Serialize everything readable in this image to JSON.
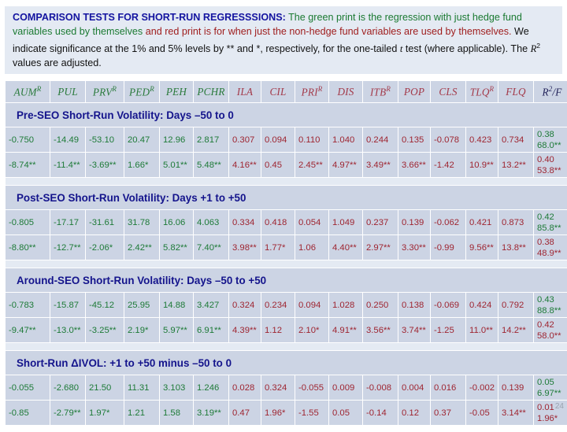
{
  "caption": {
    "lead": "COMPARISON TESTS FOR SHORT-RUN REGRESSSIONS:",
    "green1": " The green print is the regression with just hedge fund variables used by themselves ",
    "red1": "and red print is for when just the non-hedge fund variables are used by themselves.",
    "black1": " We indicate significance at the 1% and 5% levels by ** and *, respectively, for the one-tailed ",
    "t_italic": "t",
    "black2": " test (where applicable). The ",
    "r_italic": "R",
    "r_sup": "2",
    "black3": " values are adjusted."
  },
  "columns": [
    {
      "base": "AUM",
      "sup": "R",
      "color": "g"
    },
    {
      "base": "PUL",
      "sup": "",
      "color": "g"
    },
    {
      "base": "PRV",
      "sup": "R",
      "color": "g"
    },
    {
      "base": "PED",
      "sup": "R",
      "color": "g"
    },
    {
      "base": "PEH",
      "sup": "",
      "color": "g"
    },
    {
      "base": "PCHR",
      "sup": "",
      "color": "g"
    },
    {
      "base": "ILA",
      "sup": "",
      "color": "r"
    },
    {
      "base": "CIL",
      "sup": "",
      "color": "r"
    },
    {
      "base": "PRI",
      "sup": "R",
      "color": "r"
    },
    {
      "base": "DIS",
      "sup": "",
      "color": "r"
    },
    {
      "base": "ITB",
      "sup": "R",
      "color": "r"
    },
    {
      "base": "POP",
      "sup": "",
      "color": "r"
    },
    {
      "base": "CLS",
      "sup": "",
      "color": "r"
    },
    {
      "base": "TLQ",
      "sup": "R",
      "color": "r"
    },
    {
      "base": "FLQ",
      "sup": "",
      "color": "r"
    },
    {
      "base": "R",
      "sup": "2",
      "tail": "/F",
      "color": "k"
    }
  ],
  "sections": [
    {
      "title": "Pre-SEO Short-Run Volatility: Days –50 to 0",
      "rows": [
        {
          "kind": "coef",
          "cells": [
            {
              "v": "-0.750",
              "c": "g"
            },
            {
              "v": "-14.49",
              "c": "g"
            },
            {
              "v": "-53.10",
              "c": "g"
            },
            {
              "v": "20.47",
              "c": "g"
            },
            {
              "v": "12.96",
              "c": "g"
            },
            {
              "v": "2.817",
              "c": "g"
            },
            {
              "v": "0.307",
              "c": "r"
            },
            {
              "v": "0.094",
              "c": "r"
            },
            {
              "v": "0.110",
              "c": "r"
            },
            {
              "v": "1.040",
              "c": "r"
            },
            {
              "v": "0.244",
              "c": "r"
            },
            {
              "v": "0.135",
              "c": "r"
            },
            {
              "v": "-0.078",
              "c": "r"
            },
            {
              "v": "0.423",
              "c": "r"
            },
            {
              "v": "0.734",
              "c": "r"
            }
          ],
          "rsq": {
            "top": "0.38",
            "bottom": "68.0**",
            "c": "g"
          }
        },
        {
          "kind": "tstat",
          "cells": [
            {
              "v": "-8.74**",
              "c": "g"
            },
            {
              "v": "-11.4**",
              "c": "g"
            },
            {
              "v": "-3.69**",
              "c": "g"
            },
            {
              "v": "1.66*",
              "c": "g"
            },
            {
              "v": "5.01**",
              "c": "g"
            },
            {
              "v": "5.48**",
              "c": "g"
            },
            {
              "v": "4.16**",
              "c": "r"
            },
            {
              "v": "0.45",
              "c": "r"
            },
            {
              "v": "2.45**",
              "c": "r"
            },
            {
              "v": "4.97**",
              "c": "r"
            },
            {
              "v": "3.49**",
              "c": "r"
            },
            {
              "v": "3.66**",
              "c": "r"
            },
            {
              "v": "-1.42",
              "c": "r"
            },
            {
              "v": "10.9**",
              "c": "r"
            },
            {
              "v": "13.2**",
              "c": "r"
            }
          ],
          "rsq": {
            "top": "0.40",
            "bottom": "53.8**",
            "c": "r"
          }
        }
      ]
    },
    {
      "title": "Post-SEO Short-Run Volatility: Days +1 to +50",
      "rows": [
        {
          "kind": "coef",
          "cells": [
            {
              "v": "-0.805",
              "c": "g"
            },
            {
              "v": "-17.17",
              "c": "g"
            },
            {
              "v": "-31.61",
              "c": "g"
            },
            {
              "v": "31.78",
              "c": "g"
            },
            {
              "v": "16.06",
              "c": "g"
            },
            {
              "v": "4.063",
              "c": "g"
            },
            {
              "v": "0.334",
              "c": "r"
            },
            {
              "v": "0.418",
              "c": "r"
            },
            {
              "v": "0.054",
              "c": "r"
            },
            {
              "v": "1.049",
              "c": "r"
            },
            {
              "v": "0.237",
              "c": "r"
            },
            {
              "v": "0.139",
              "c": "r"
            },
            {
              "v": "-0.062",
              "c": "r"
            },
            {
              "v": "0.421",
              "c": "r"
            },
            {
              "v": "0.873",
              "c": "r"
            }
          ],
          "rsq": {
            "top": "0.42",
            "bottom": "85.8**",
            "c": "g"
          }
        },
        {
          "kind": "tstat",
          "cells": [
            {
              "v": "-8.80**",
              "c": "g"
            },
            {
              "v": "-12.7**",
              "c": "g"
            },
            {
              "v": "-2.06*",
              "c": "g"
            },
            {
              "v": "2.42**",
              "c": "g"
            },
            {
              "v": "5.82**",
              "c": "g"
            },
            {
              "v": "7.40**",
              "c": "g"
            },
            {
              "v": "3.98**",
              "c": "r"
            },
            {
              "v": "1.77*",
              "c": "r"
            },
            {
              "v": "1.06",
              "c": "r"
            },
            {
              "v": "4.40**",
              "c": "r"
            },
            {
              "v": "2.97**",
              "c": "r"
            },
            {
              "v": "3.30**",
              "c": "r"
            },
            {
              "v": "-0.99",
              "c": "r"
            },
            {
              "v": "9.56**",
              "c": "r"
            },
            {
              "v": "13.8**",
              "c": "r"
            }
          ],
          "rsq": {
            "top": "0.38",
            "bottom": "48.9**",
            "c": "r"
          }
        }
      ]
    },
    {
      "title": "Around-SEO Short-Run Volatility: Days –50 to +50",
      "rows": [
        {
          "kind": "coef",
          "cells": [
            {
              "v": "-0.783",
              "c": "g"
            },
            {
              "v": "-15.87",
              "c": "g"
            },
            {
              "v": "-45.12",
              "c": "g"
            },
            {
              "v": "25.95",
              "c": "g"
            },
            {
              "v": "14.88",
              "c": "g"
            },
            {
              "v": "3.427",
              "c": "g"
            },
            {
              "v": "0.324",
              "c": "r"
            },
            {
              "v": "0.234",
              "c": "r"
            },
            {
              "v": "0.094",
              "c": "r"
            },
            {
              "v": "1.028",
              "c": "r"
            },
            {
              "v": "0.250",
              "c": "r"
            },
            {
              "v": "0.138",
              "c": "r"
            },
            {
              "v": "-0.069",
              "c": "r"
            },
            {
              "v": "0.424",
              "c": "r"
            },
            {
              "v": "0.792",
              "c": "r"
            }
          ],
          "rsq": {
            "top": "0.43",
            "bottom": "88.8**",
            "c": "g"
          }
        },
        {
          "kind": "tstat",
          "cells": [
            {
              "v": "-9.47**",
              "c": "g"
            },
            {
              "v": "-13.0**",
              "c": "g"
            },
            {
              "v": "-3.25**",
              "c": "g"
            },
            {
              "v": "2.19*",
              "c": "g"
            },
            {
              "v": "5.97**",
              "c": "g"
            },
            {
              "v": "6.91**",
              "c": "g"
            },
            {
              "v": "4.39**",
              "c": "r"
            },
            {
              "v": "1.12",
              "c": "r"
            },
            {
              "v": "2.10*",
              "c": "r"
            },
            {
              "v": "4.91**",
              "c": "r"
            },
            {
              "v": "3.56**",
              "c": "r"
            },
            {
              "v": "3.74**",
              "c": "r"
            },
            {
              "v": "-1.25",
              "c": "r"
            },
            {
              "v": "11.0**",
              "c": "r"
            },
            {
              "v": "14.2**",
              "c": "r"
            }
          ],
          "rsq": {
            "top": "0.42",
            "bottom": "58.0**",
            "c": "r"
          }
        }
      ]
    },
    {
      "title": "Short-Run ΔIVOL: +1 to +50 minus –50 to 0",
      "rows": [
        {
          "kind": "coef",
          "cells": [
            {
              "v": "-0.055",
              "c": "g"
            },
            {
              "v": "-2.680",
              "c": "g"
            },
            {
              "v": "21.50",
              "c": "g"
            },
            {
              "v": "11.31",
              "c": "g"
            },
            {
              "v": "3.103",
              "c": "g"
            },
            {
              "v": "1.246",
              "c": "g"
            },
            {
              "v": "0.028",
              "c": "r"
            },
            {
              "v": "0.324",
              "c": "r"
            },
            {
              "v": "-0.055",
              "c": "r"
            },
            {
              "v": "0.009",
              "c": "r"
            },
            {
              "v": "-0.008",
              "c": "r"
            },
            {
              "v": "0.004",
              "c": "r"
            },
            {
              "v": "0.016",
              "c": "r"
            },
            {
              "v": "-0.002",
              "c": "r"
            },
            {
              "v": "0.139",
              "c": "r"
            }
          ],
          "rsq": {
            "top": "0.05",
            "bottom": "6.97**",
            "c": "g"
          }
        },
        {
          "kind": "tstat",
          "cells": [
            {
              "v": "-0.85",
              "c": "g"
            },
            {
              "v": "-2.79**",
              "c": "g"
            },
            {
              "v": "1.97*",
              "c": "g"
            },
            {
              "v": "1.21",
              "c": "g"
            },
            {
              "v": "1.58",
              "c": "g"
            },
            {
              "v": "3.19**",
              "c": "g"
            },
            {
              "v": "0.47",
              "c": "r"
            },
            {
              "v": "1.96*",
              "c": "r"
            },
            {
              "v": "-1.55",
              "c": "r"
            },
            {
              "v": "0.05",
              "c": "r"
            },
            {
              "v": "-0.14",
              "c": "r"
            },
            {
              "v": "0.12",
              "c": "r"
            },
            {
              "v": "0.37",
              "c": "r"
            },
            {
              "v": "-0.05",
              "c": "r"
            },
            {
              "v": "3.14**",
              "c": "r"
            }
          ],
          "rsq": {
            "top": "0.01",
            "bottom": "1.96*",
            "c": "r"
          }
        }
      ]
    }
  ],
  "page_number": "24",
  "palette": {
    "green": "#1d7a37",
    "red": "#9e2430",
    "blue": "#14148c",
    "cell_bg": "#ccd4e4",
    "band_bg": "#e4eaf3"
  }
}
